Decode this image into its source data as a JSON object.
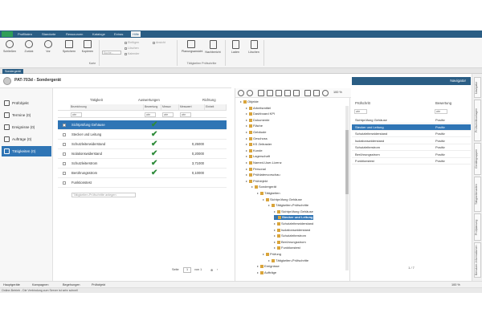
{
  "menubar": {
    "tabs": [
      "Profiltaten",
      "Standorte",
      "Ressourcen",
      "Kataloge",
      "Extras",
      "Hilfe"
    ],
    "active_index": 5
  },
  "ribbon": {
    "buttons": [
      "Schließen",
      "Zurück",
      "Vor",
      "Speichern",
      "Kopieren"
    ],
    "group_karte": "Karte",
    "options": [
      "Einfügen",
      "Ansicht",
      "Löschen",
      "Kalender"
    ],
    "field_placeholder": "Suche...",
    "group2_buttons": [
      "Planungsansicht",
      "Nachbericht"
    ],
    "group2_title": "Tätigkeiten Prüfschritte",
    "group3_buttons": [
      "Laden",
      "Löschen"
    ]
  },
  "doc_tab": "Sondergerät",
  "page_title": "PAT-703d - Sondergerät",
  "leftnav": [
    {
      "label": "Prüfobjekt",
      "active": false
    },
    {
      "label": "Termine (0)",
      "active": false
    },
    {
      "label": "Ereignisse (0)",
      "active": false
    },
    {
      "label": "Aufträge (0)",
      "active": false
    },
    {
      "label": "Tätigkeiten (0)",
      "active": true
    }
  ],
  "grid": {
    "head1": {
      "taetigkeit": "Tätigkeit",
      "auswertungen": "Auswertungen",
      "richtung": "Richtung"
    },
    "columns": [
      "Bezeichnung",
      "Bewertung",
      "Messw",
      "Messwert",
      "Einheit"
    ],
    "filter_values": [
      "wie",
      "wie",
      "wie",
      "wie"
    ],
    "rows": [
      {
        "name": "Sichtprüfung Gehäuse",
        "check": true,
        "value": "",
        "selected": true
      },
      {
        "name": "Stecker und Leitung",
        "check": true,
        "value": "",
        "selected": false
      },
      {
        "name": "Schutzleiterwiderstand",
        "check": true,
        "value": "0,25000",
        "selected": false
      },
      {
        "name": "Isolationswiderstand",
        "check": true,
        "value": "0,20000",
        "selected": false
      },
      {
        "name": "Schutzleiterstrom",
        "check": true,
        "value": "3,71000",
        "selected": false
      },
      {
        "name": "Berührungsstrom",
        "check": true,
        "value": "0,10000",
        "selected": false
      },
      {
        "name": "Funktionstest",
        "check": false,
        "value": "",
        "selected": false
      }
    ],
    "add_placeholder": "Tätigkeiten-Prüfschritte anlegen",
    "pager": {
      "label": "Seite",
      "page": "1",
      "of": "von 1"
    }
  },
  "tree": {
    "nodes": [
      {
        "label": "Objekte",
        "level": 0
      },
      {
        "label": "Arbeitsmittel",
        "level": 1
      },
      {
        "label": "Dashboard KPI",
        "level": 1
      },
      {
        "label": "Dokumente",
        "level": 1
      },
      {
        "label": "Fläche",
        "level": 1
      },
      {
        "label": "Gebäude",
        "level": 1
      },
      {
        "label": "Geschoss",
        "level": 1
      },
      {
        "label": "KS Zeitraster",
        "level": 1
      },
      {
        "label": "Kunde",
        "level": 1
      },
      {
        "label": "Lagerschaft",
        "level": 1
      },
      {
        "label": "Named-User-Lizenz",
        "level": 1
      },
      {
        "label": "Personal",
        "level": 1
      },
      {
        "label": "Prüfdatenvorschau",
        "level": 1
      },
      {
        "label": "Prüfobjekt",
        "level": 1
      },
      {
        "label": "Sondergerät",
        "level": 2
      },
      {
        "label": "Tätigkeiten",
        "level": 3
      },
      {
        "label": "Sichtprüfung Gehäuse",
        "level": 4
      },
      {
        "label": "Tätigkeiten-Prüfschritte",
        "level": 5
      },
      {
        "label": "Sichtprüfung Gehäuse",
        "level": 6
      },
      {
        "label": "Stecker und Leitung",
        "level": 6,
        "highlight": true
      },
      {
        "label": "Schutzleiterwiderstand",
        "level": 6
      },
      {
        "label": "Isolationswiderstand",
        "level": 6
      },
      {
        "label": "Schutzleiterstrom",
        "level": 6
      },
      {
        "label": "Berührungsstrom",
        "level": 6
      },
      {
        "label": "Funktionstest",
        "level": 6
      },
      {
        "label": "Prüfung",
        "level": 4
      },
      {
        "label": "Tätigkeiten-Prüfschritte",
        "level": 5
      },
      {
        "label": "Ereignisse",
        "level": 3
      },
      {
        "label": "Aufträge",
        "level": 3
      }
    ],
    "zoom": "100 %"
  },
  "navigator": {
    "title": "Navigator",
    "col1": "Prüfschritt",
    "col2": "Bewertung",
    "filter": [
      "wie",
      "wie"
    ],
    "rows": [
      {
        "name": "Sichtprüfung Gehäuse",
        "bew": "Positiv",
        "selected": false
      },
      {
        "name": "Stecker und Leitung",
        "bew": "Positiv",
        "selected": true
      },
      {
        "name": "Schutzleiterwiderstand",
        "bew": "Positiv",
        "selected": false
      },
      {
        "name": "Isolationswiderstand",
        "bew": "Positiv",
        "selected": false
      },
      {
        "name": "Schutzleiterstrom",
        "bew": "Positiv",
        "selected": false
      },
      {
        "name": "Berührungsstrom",
        "bew": "Positiv",
        "selected": false
      },
      {
        "name": "Funktionstest",
        "bew": "Positiv",
        "selected": false
      }
    ],
    "pager": "1 / 7"
  },
  "sidetabs": [
    "Navigator",
    "Prüfschrittvorlagen",
    "Gerätegruppen",
    "Tätigkeitenarten",
    "Prüfplanung",
    "Benutzer-Informationen"
  ],
  "bottombar": {
    "items": [
      "Hauptgeräte",
      "Kampagnen",
      "Begehungen",
      "Prüfobjekt"
    ],
    "zoom": "100 %"
  },
  "status": "Online-Betrieb - Die Verbindung zum Server ist sehr schnell"
}
